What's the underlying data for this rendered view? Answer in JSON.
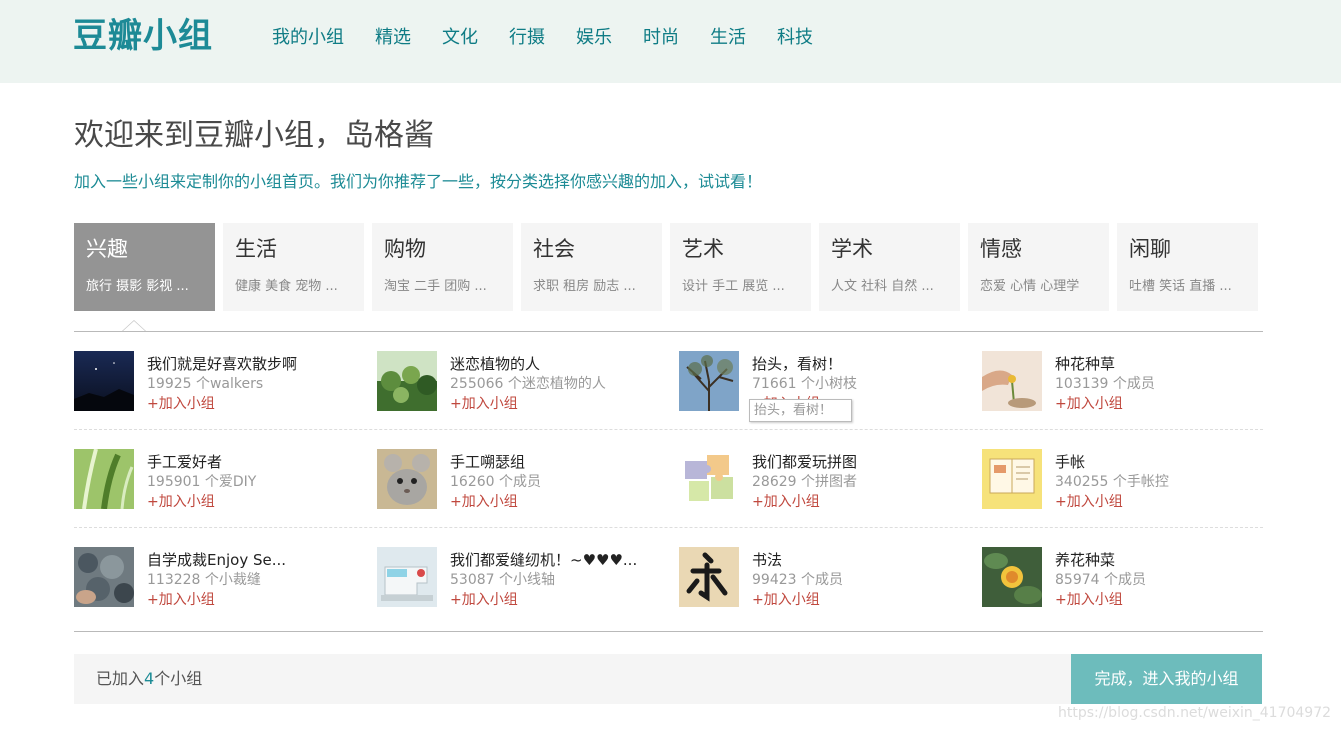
{
  "header": {
    "logo": "豆瓣小组",
    "nav": [
      "我的小组",
      "精选",
      "文化",
      "行摄",
      "娱乐",
      "时尚",
      "生活",
      "科技"
    ]
  },
  "welcome": {
    "title": "欢迎来到豆瓣小组，岛格酱",
    "subtitle": "加入一些小组来定制你的小组首页。我们为你推荐了一些，按分类选择你感兴趣的加入，试试看！"
  },
  "categories": [
    {
      "title": "兴趣",
      "sub": "旅行 摄影 影视 ...",
      "active": true
    },
    {
      "title": "生活",
      "sub": "健康 美食 宠物 ...",
      "active": false
    },
    {
      "title": "购物",
      "sub": "淘宝 二手 团购 ...",
      "active": false
    },
    {
      "title": "社会",
      "sub": "求职 租房 励志 ...",
      "active": false
    },
    {
      "title": "艺术",
      "sub": "设计 手工 展览 ...",
      "active": false
    },
    {
      "title": "学术",
      "sub": "人文 社科 自然 ...",
      "active": false
    },
    {
      "title": "情感",
      "sub": "恋爱 心情 心理学",
      "active": false
    },
    {
      "title": "闲聊",
      "sub": "吐槽 笑话 直播 ...",
      "active": false
    }
  ],
  "join_label": "+加入小组",
  "groups": [
    {
      "name": "我们就是好喜欢散步啊",
      "count": "19925 个walkers",
      "icon": "night-sky-thumbnail"
    },
    {
      "name": "迷恋植物的人",
      "count": "255066 个迷恋植物的人",
      "icon": "plants-thumbnail"
    },
    {
      "name": "抬头，看树！",
      "count": "71661 个小树枝",
      "icon": "tree-thumbnail"
    },
    {
      "name": "种花种草",
      "count": "103139 个成员",
      "icon": "flower-hand-thumbnail"
    },
    {
      "name": "手工爱好者",
      "count": "195901 个爱DIY",
      "icon": "green-leaves-thumbnail"
    },
    {
      "name": "手工嗍瑟组",
      "count": "16260 个成员",
      "icon": "chinchilla-thumbnail"
    },
    {
      "name": "我们都爱玩拼图",
      "count": "28629 个拼图者",
      "icon": "puzzle-thumbnail"
    },
    {
      "name": "手帐",
      "count": "340255 个手帐控",
      "icon": "notebook-thumbnail"
    },
    {
      "name": "自学成裁Enjoy Se...",
      "count": "113228 个小裁缝",
      "icon": "fabric-thumbnail"
    },
    {
      "name": "我们都爱缝纫机！~♥♥♥...",
      "count": "53087 个小线轴",
      "icon": "sewing-machine-thumbnail"
    },
    {
      "name": "书法",
      "count": "99423 个成员",
      "icon": "calligraphy-thumbnail"
    },
    {
      "name": "养花种菜",
      "count": "85974 个成员",
      "icon": "yellow-rose-thumbnail"
    }
  ],
  "tooltip": "抬头，看树！",
  "footer": {
    "joined_prefix": "已加入",
    "joined_count": "4",
    "joined_suffix": "个小组",
    "done_button": "完成，进入我的小组"
  },
  "watermark": "https://blog.csdn.net/weixin_41704972",
  "colors": {
    "brand": "#1d8a96",
    "join": "#c0483e",
    "done_button": "#6dbcbc",
    "active_category": "#949494"
  }
}
